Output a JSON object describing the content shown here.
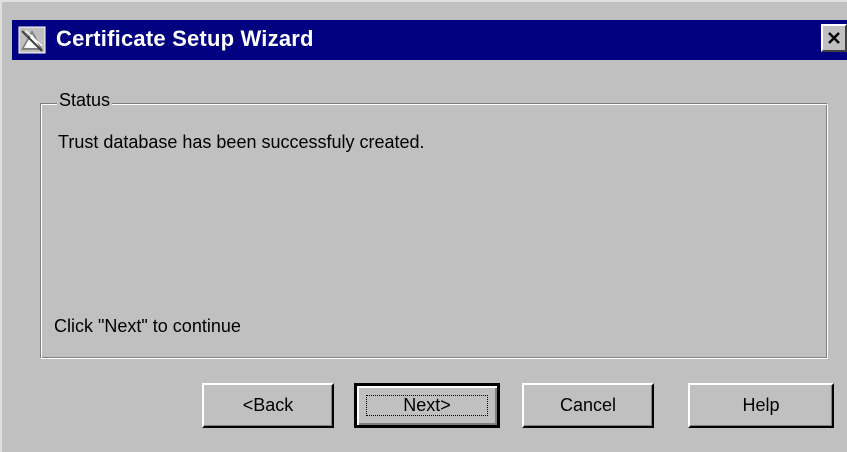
{
  "window": {
    "title": "Certificate Setup Wizard",
    "title_icon": "certificate-wizard-icon",
    "close_icon": "close-icon"
  },
  "status_group": {
    "legend": "Status",
    "message": "Trust database has been successfuly created.",
    "hint": "Click \"Next\" to continue"
  },
  "buttons": {
    "back": "<Back",
    "next": "Next>",
    "cancel": "Cancel",
    "help": "Help"
  },
  "colors": {
    "title_bar": "#000080",
    "window_bg": "#c0c0c0",
    "title_text": "#ffffff"
  }
}
